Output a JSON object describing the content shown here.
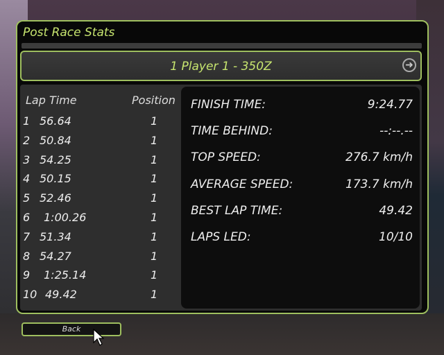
{
  "panel": {
    "title": "Post Race Stats"
  },
  "player": {
    "label": "1   Player 1 - 350Z"
  },
  "laps": {
    "header_lap_time": "Lap Time",
    "header_position": "Position",
    "rows": [
      {
        "num": "1",
        "time": "56.64",
        "pos": "1"
      },
      {
        "num": "2",
        "time": "50.84",
        "pos": "1"
      },
      {
        "num": "3",
        "time": "54.25",
        "pos": "1"
      },
      {
        "num": "4",
        "time": "50.15",
        "pos": "1"
      },
      {
        "num": "5",
        "time": "52.46",
        "pos": "1"
      },
      {
        "num": "6",
        "time": "1:00.26",
        "pos": "1"
      },
      {
        "num": "7",
        "time": "51.34",
        "pos": "1"
      },
      {
        "num": "8",
        "time": "54.27",
        "pos": "1"
      },
      {
        "num": "9",
        "time": "1:25.14",
        "pos": "1"
      },
      {
        "num": "10",
        "time": "49.42",
        "pos": "1"
      }
    ]
  },
  "stats": [
    {
      "label": "FINISH TIME:",
      "value": "9:24.77"
    },
    {
      "label": "TIME BEHIND:",
      "value": "--:--.--"
    },
    {
      "label": "TOP SPEED:",
      "value": "276.7 km/h"
    },
    {
      "label": "AVERAGE SPEED:",
      "value": "173.7 km/h"
    },
    {
      "label": "BEST LAP TIME:",
      "value": "49.42"
    },
    {
      "label": "LAPS LED:",
      "value": "10/10"
    }
  ],
  "back_button": {
    "label": "Back"
  },
  "colors": {
    "accent": "#9fbf5f",
    "title": "#c7e56f"
  }
}
